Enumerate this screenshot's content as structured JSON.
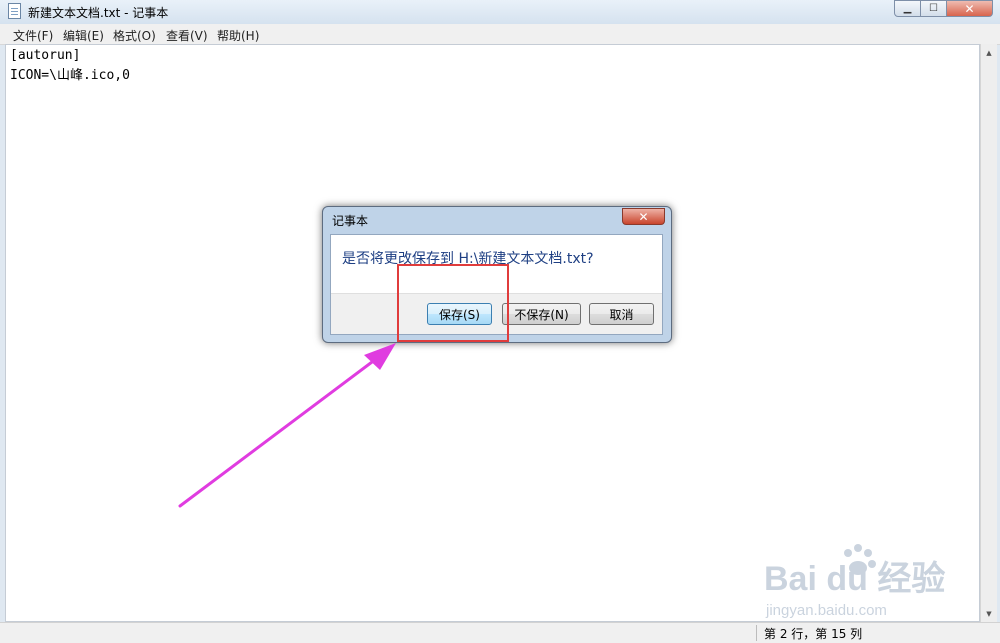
{
  "window": {
    "title": "新建文本文档.txt - 记事本",
    "controls": {
      "minimize": "▁",
      "maximize": "☐",
      "close": "✕"
    }
  },
  "menubar": {
    "items": [
      {
        "label": "文件(F)"
      },
      {
        "label": "编辑(E)"
      },
      {
        "label": "格式(O)"
      },
      {
        "label": "查看(V)"
      },
      {
        "label": "帮助(H)"
      }
    ]
  },
  "editor": {
    "lines": [
      "[autorun]",
      "ICON=\\山峰.ico,0"
    ]
  },
  "statusbar": {
    "position": "第 2 行，第 15 列"
  },
  "dialog": {
    "title": "记事本",
    "message": "是否将更改保存到 H:\\新建文本文档.txt?",
    "buttons": {
      "save": "保存(S)",
      "dont_save": "不保存(N)",
      "cancel": "取消"
    },
    "close": "✕"
  },
  "annotation": {
    "highlight_color": "#e03c3c",
    "arrow_color": "#e03ce0"
  },
  "watermark": {
    "brand": "Bai du 经验",
    "url": "jingyan.baidu.com"
  }
}
